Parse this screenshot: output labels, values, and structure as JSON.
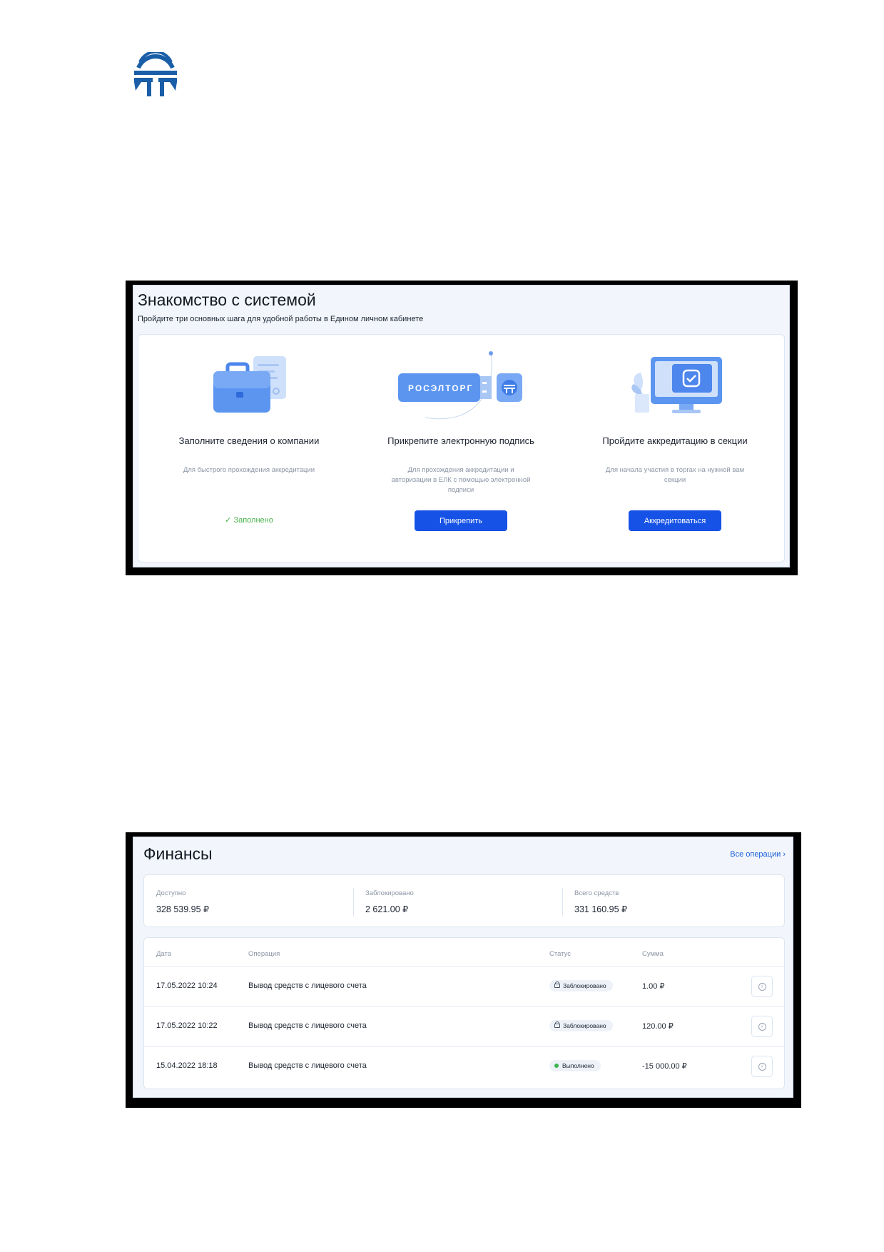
{
  "onboarding": {
    "title": "Знакомство с системой",
    "subtitle": "Пройдите три основных шага для удобной работы в Едином личном кабинете",
    "steps": [
      {
        "title": "Заполните сведения о компании",
        "description": "Для быстрого прохождения аккредитации",
        "status": "Заполнено",
        "illustration": "briefcase-document-icon"
      },
      {
        "title": "Прикрепите электронную подпись",
        "description": "Для прохождения аккредитации и авторизации в ЕЛК с помощью электронной подписи",
        "button": "Прикрепить",
        "illustration": "usb-token-icon",
        "token_text": "РОСЭЛТОРГ"
      },
      {
        "title": "Пройдите аккредитацию в секции",
        "description": "Для начала участия в торгах на нужной вам секции",
        "button": "Аккредитоваться",
        "illustration": "monitor-checkmark-icon"
      }
    ]
  },
  "finance": {
    "title": "Финансы",
    "all_operations_link": "Все операции",
    "balances": [
      {
        "label": "Доступно",
        "value": "328 539.95 ₽"
      },
      {
        "label": "Заблокировано",
        "value": "2 621.00 ₽"
      },
      {
        "label": "Всего средств",
        "value": "331 160.95 ₽"
      }
    ],
    "table": {
      "columns": {
        "date": "Дата",
        "operation": "Операция",
        "status": "Статус",
        "amount": "Сумма"
      },
      "rows": [
        {
          "date": "17.05.2022 10:24",
          "operation": "Вывод средств с лицевого счета",
          "status": "Заблокировано",
          "status_type": "blocked",
          "amount": "1.00  ₽"
        },
        {
          "date": "17.05.2022 10:22",
          "operation": "Вывод средств с лицевого счета",
          "status": "Заблокировано",
          "status_type": "blocked",
          "amount": "120.00  ₽"
        },
        {
          "date": "15.04.2022 18:18",
          "operation": "Вывод средств с лицевого счета",
          "status": "Выполнено",
          "status_type": "done",
          "amount": "-15 000.00  ₽"
        }
      ]
    }
  },
  "colors": {
    "brand_blue": "#1652e6",
    "logo_blue": "#1a5ea8",
    "success_green": "#46b04a",
    "link_blue": "#1a5fd8"
  }
}
